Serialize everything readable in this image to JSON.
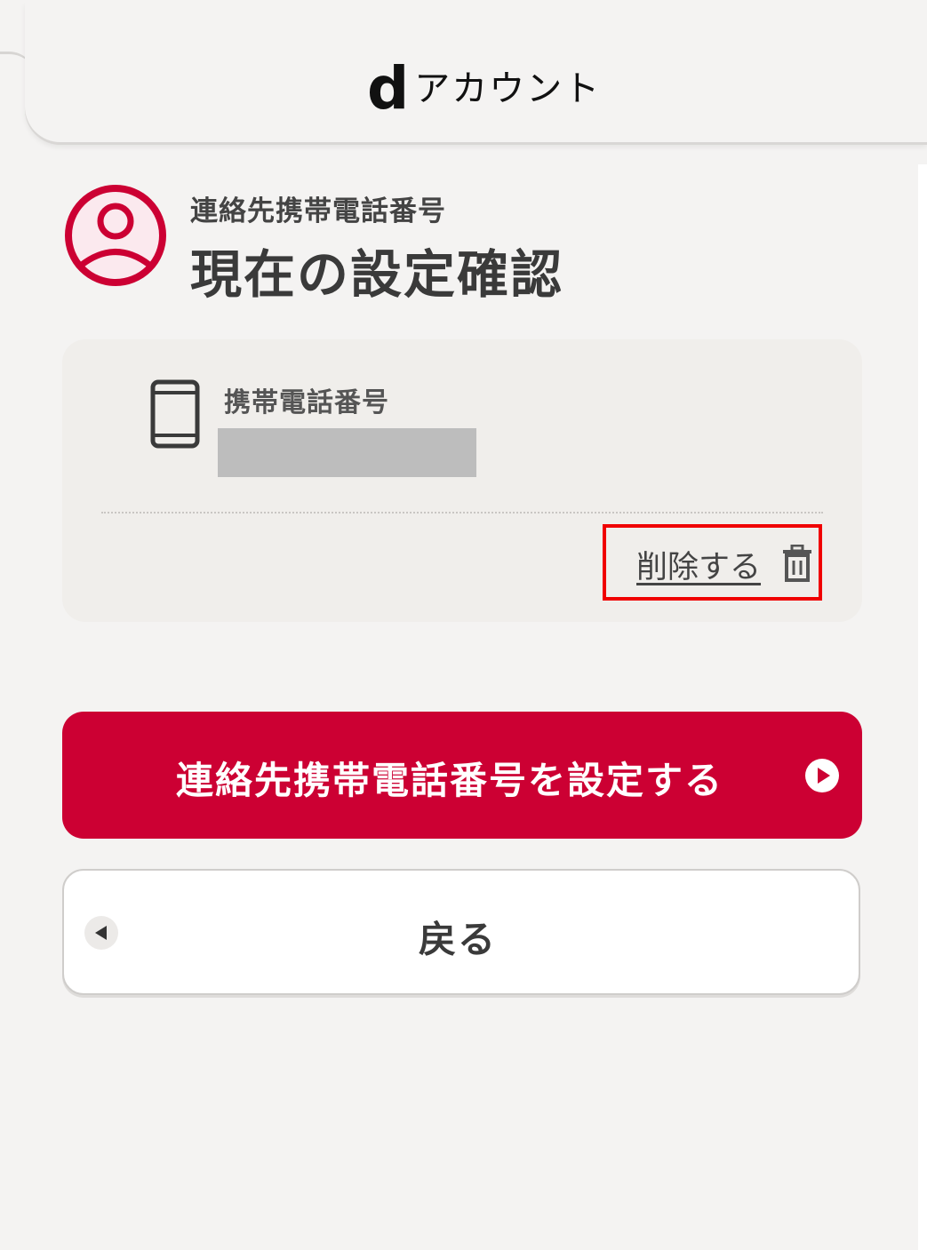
{
  "header": {
    "logo_d": "d",
    "logo_text": "アカウント"
  },
  "page": {
    "subtitle": "連絡先携帯電話番号",
    "title": "現在の設定確認"
  },
  "card": {
    "phone_label": "携帯電話番号",
    "phone_value": "",
    "delete_label": "削除する"
  },
  "buttons": {
    "primary_label": "連絡先携帯電話番号を設定する",
    "back_label": "戻る"
  },
  "colors": {
    "accent": "#cc0033",
    "highlight": "#f00000",
    "redacted": "#bdbdbd"
  },
  "icons": {
    "avatar": "user-circle-icon",
    "phone": "smartphone-icon",
    "delete": "trash-icon",
    "primary": "play-circle-icon",
    "back": "back-arrow-icon"
  }
}
